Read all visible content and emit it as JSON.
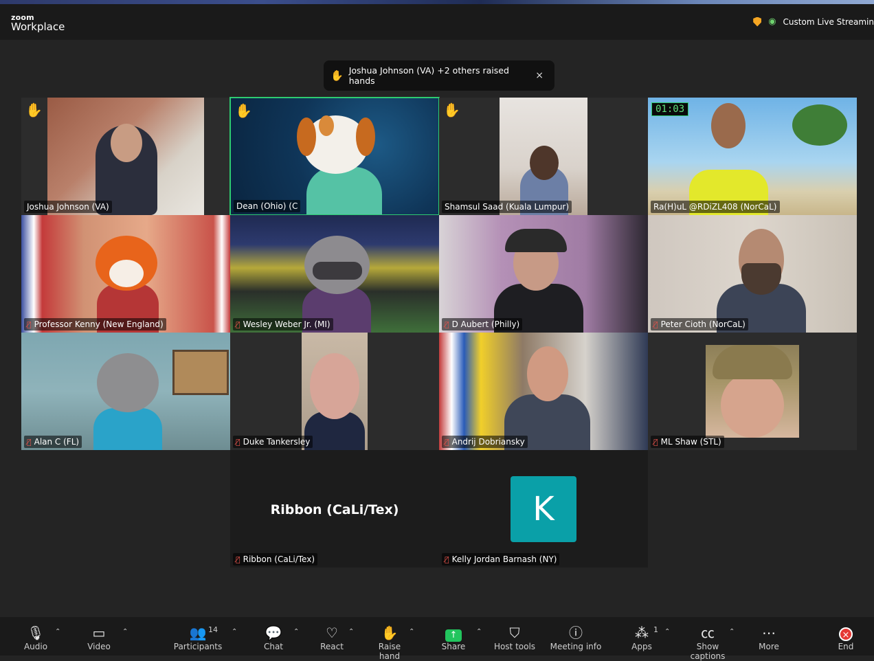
{
  "app": {
    "brand_top": "zoom",
    "brand_bottom": "Workplace"
  },
  "status": {
    "stream_label": "Custom Live Streamin"
  },
  "banner": {
    "text": "Joshua Johnson (VA) +2 others raised hands",
    "close": "×"
  },
  "tiles": [
    {
      "name": "Joshua Johnson (VA)"
    },
    {
      "name": "Dean (Ohio) (C"
    },
    {
      "name": "Shamsul Saad (Kuala Lumpur)"
    },
    {
      "name": "Ra(H)uL @RDiZL408 (NorCaL)",
      "timer": "01:03"
    },
    {
      "name": "Professor Kenny (New England)"
    },
    {
      "name": "Wesley Weber Jr. (MI)"
    },
    {
      "name": "D Aubert (Philly)"
    },
    {
      "name": "Peter Cioth (NorCaL)"
    },
    {
      "name": "Alan C (FL)"
    },
    {
      "name": "Duke Tankersley"
    },
    {
      "name": "Andrij Dobriansky"
    },
    {
      "name": "ML Shaw (STL)"
    },
    {
      "name": "Ribbon (CaLi/Tex)",
      "big": "Ribbon (CaLi/Tex)"
    },
    {
      "name": "Kelly Jordan Barnash (NY)",
      "initial": "K"
    }
  ],
  "toolbar": {
    "audio": "Audio",
    "video": "Video",
    "participants": "Participants",
    "participants_count": "14",
    "chat": "Chat",
    "react": "React",
    "raise_hand": "Raise hand",
    "share": "Share",
    "host_tools": "Host tools",
    "meeting_info": "Meeting info",
    "apps": "Apps",
    "apps_count": "1",
    "captions": "Show captions",
    "more": "More",
    "end": "End"
  },
  "colors": {
    "active_border": "#2ecc71",
    "muted_red": "#e5534b",
    "share_green": "#22c55e",
    "end_red": "#e53935",
    "k_teal": "#0aa0a8"
  }
}
